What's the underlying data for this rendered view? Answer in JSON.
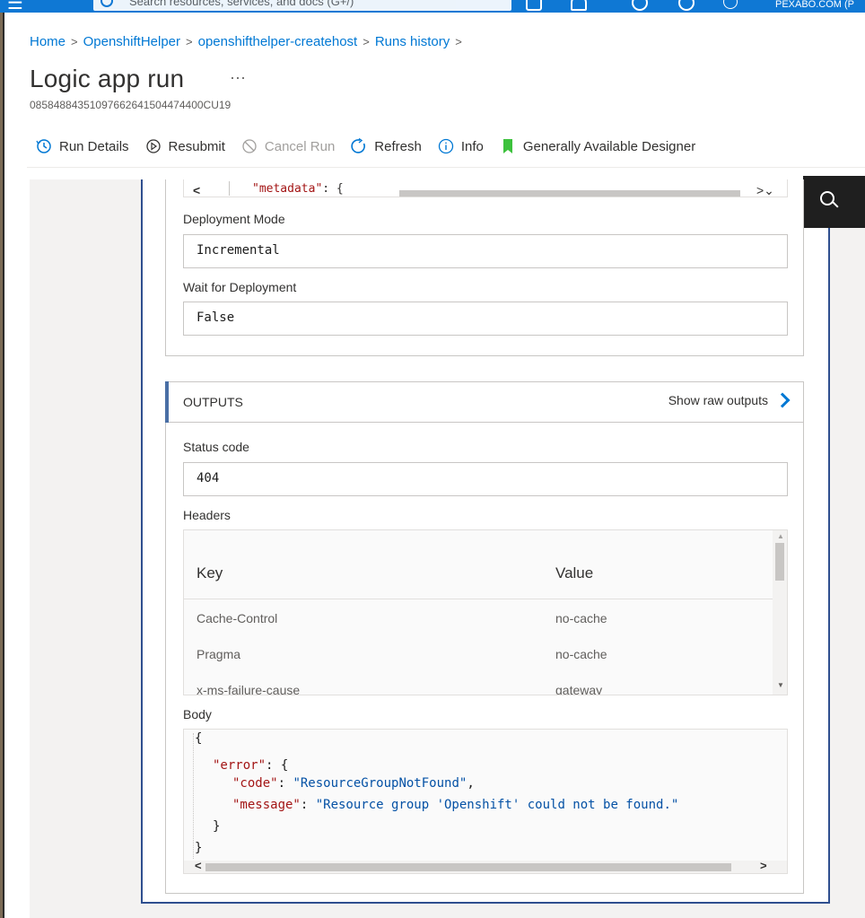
{
  "topbar": {
    "search_placeholder": "Search resources, services, and docs (G+/)",
    "user": "PEXABO.COM (P"
  },
  "breadcrumb": {
    "items": [
      "Home",
      "OpenshiftHelper",
      "openshifthelper-createhost",
      "Runs history"
    ],
    "separator": ">"
  },
  "page": {
    "title": "Logic app run",
    "more": "···",
    "run_id": "08584884351097662641504474400CU19"
  },
  "toolbar": {
    "run_details": "Run Details",
    "resubmit": "Resubmit",
    "cancel_run": "Cancel Run",
    "refresh": "Refresh",
    "info": "Info",
    "designer": "Generally Available Designer"
  },
  "inputs": {
    "metadata_key": "\"metadata\"",
    "metadata_rest": ": {",
    "deployment_mode_label": "Deployment Mode",
    "deployment_mode_value": "Incremental",
    "wait_label": "Wait for Deployment",
    "wait_value": "False"
  },
  "outputs": {
    "title": "OUTPUTS",
    "raw_link": "Show raw outputs",
    "status_label": "Status code",
    "status_value": "404",
    "headers_label": "Headers",
    "headers_columns": {
      "key": "Key",
      "value": "Value"
    },
    "headers_rows": [
      {
        "key": "Cache-Control",
        "value": "no-cache"
      },
      {
        "key": "Pragma",
        "value": "no-cache"
      },
      {
        "key": "x-ms-failure-cause",
        "value": "gateway"
      }
    ],
    "body_label": "Body",
    "body": {
      "open_brace": "{",
      "error_key": "\"error\"",
      "error_rest": ": {",
      "code_key": "\"code\"",
      "code_value": "\"ResourceGroupNotFound\"",
      "message_key": "\"message\"",
      "message_value": "\"Resource group 'Openshift' could not be found.\"",
      "inner_close": "}",
      "close_brace": "}"
    }
  },
  "colors": {
    "accent": "#0078d4",
    "json_key": "#a31515",
    "json_string": "#0451a5",
    "card_border": "#2f4f8f"
  }
}
